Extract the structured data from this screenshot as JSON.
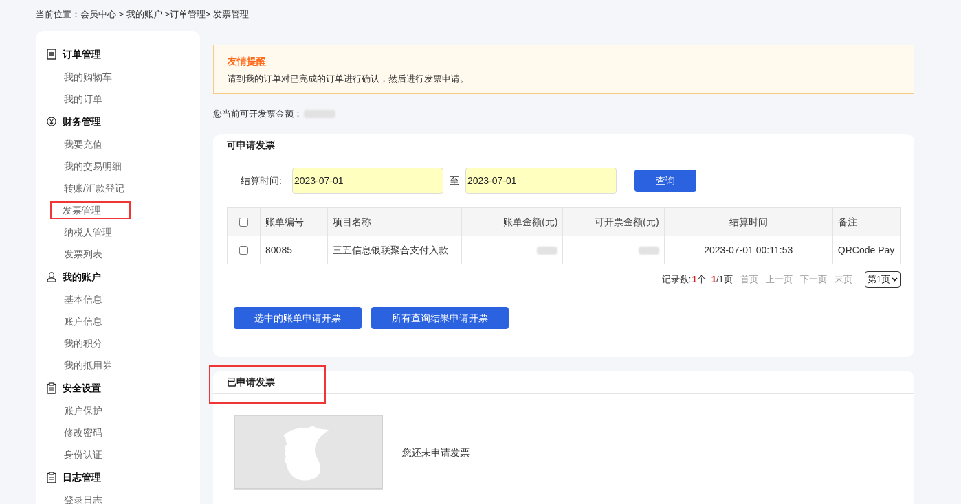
{
  "breadcrumb": {
    "label": "当前位置：",
    "path": "会员中心 > 我的账户 >订单管理> 发票管理"
  },
  "sidebar": {
    "groups": [
      {
        "title": "订单管理",
        "items": [
          {
            "label": "我的购物车",
            "annotated": false
          },
          {
            "label": "我的订单",
            "annotated": false
          }
        ]
      },
      {
        "title": "财务管理",
        "items": [
          {
            "label": "我要充值",
            "annotated": false
          },
          {
            "label": "我的交易明细",
            "annotated": false
          },
          {
            "label": "转账/汇款登记",
            "annotated": false
          },
          {
            "label": "发票管理",
            "annotated": true
          },
          {
            "label": "纳税人管理",
            "annotated": false
          },
          {
            "label": "发票列表",
            "annotated": false
          }
        ]
      },
      {
        "title": "我的账户",
        "items": [
          {
            "label": "基本信息",
            "annotated": false
          },
          {
            "label": "账户信息",
            "annotated": false
          },
          {
            "label": "我的积分",
            "annotated": false
          },
          {
            "label": "我的抵用券",
            "annotated": false
          }
        ]
      },
      {
        "title": "安全设置",
        "items": [
          {
            "label": "账户保护",
            "annotated": false
          },
          {
            "label": "修改密码",
            "annotated": false
          },
          {
            "label": "身份认证",
            "annotated": false
          }
        ]
      },
      {
        "title": "日志管理",
        "items": [
          {
            "label": "登录日志",
            "annotated": false
          }
        ]
      }
    ]
  },
  "notice": {
    "title": "友情提醒",
    "text": "请到我的订单对已完成的订单进行确认，然后进行发票申请。"
  },
  "amount": {
    "label": "您当前可开发票金额："
  },
  "available": {
    "title": "可申请发票",
    "annotated": false,
    "filter": {
      "label": "结算时间:",
      "from": "2023-07-01",
      "separator": "至",
      "to": "2023-07-01",
      "button": "查询"
    },
    "table": {
      "select_all_checked": false,
      "columns": [
        "账单编号",
        "项目名称",
        "账单金额(元)",
        "可开票金额(元)",
        "结算时间",
        "备注"
      ],
      "rows": [
        {
          "checked": false,
          "cells": [
            "80085",
            "三五信息银联聚合支付入款",
            null,
            null,
            "2023-07-01 00:11:53",
            "QRCode Pay"
          ]
        }
      ]
    },
    "pagination": {
      "label": "记录数:",
      "count": "1",
      "count_unit": "个",
      "page": "1",
      "pages": "/1页",
      "links": [
        "首页",
        "上一页",
        "下一页",
        "末页"
      ],
      "select": "第1页"
    },
    "buttons": [
      "选中的账单申请开票",
      "所有查询结果申请开票"
    ]
  },
  "applied": {
    "title": "已申请发票",
    "annotated": true,
    "empty_text": "您还未申请发票"
  }
}
